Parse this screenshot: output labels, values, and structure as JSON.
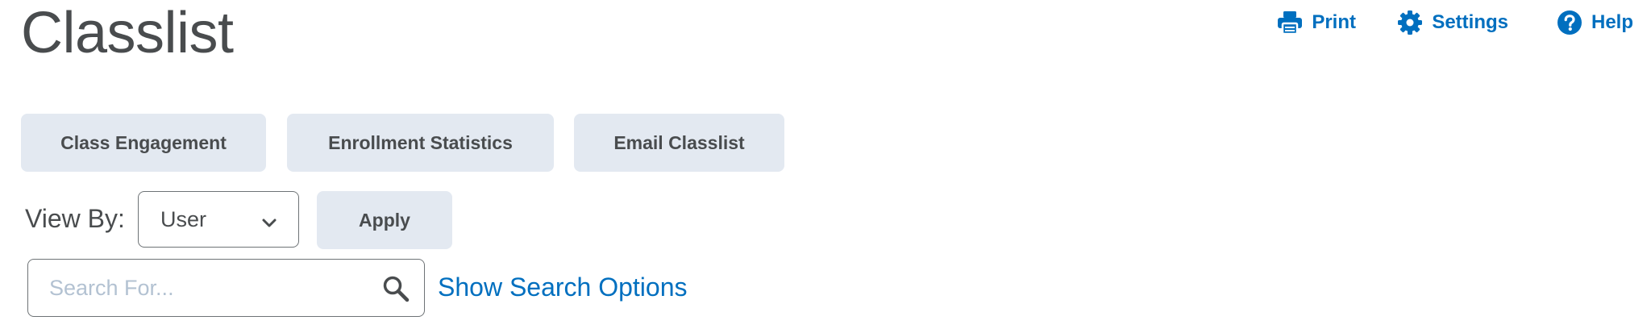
{
  "page": {
    "title": "Classlist"
  },
  "toolbar": {
    "print_label": "Print",
    "settings_label": "Settings",
    "help_label": "Help"
  },
  "actions": {
    "class_engagement": "Class Engagement",
    "enrollment_statistics": "Enrollment Statistics",
    "email_classlist": "Email Classlist"
  },
  "view_by": {
    "label": "View By:",
    "selected": "User",
    "apply_label": "Apply"
  },
  "search": {
    "placeholder": "Search For...",
    "value": "",
    "show_options_label": "Show Search Options"
  },
  "colors": {
    "link": "#006fbf",
    "button_bg": "#e3e9f1",
    "text": "#494c4e",
    "placeholder": "#b3c2d2"
  },
  "icons": {
    "print": "printer-icon",
    "settings": "gear-icon",
    "help": "help-circle-icon",
    "select": "chevron-down-icon",
    "search": "search-icon"
  }
}
